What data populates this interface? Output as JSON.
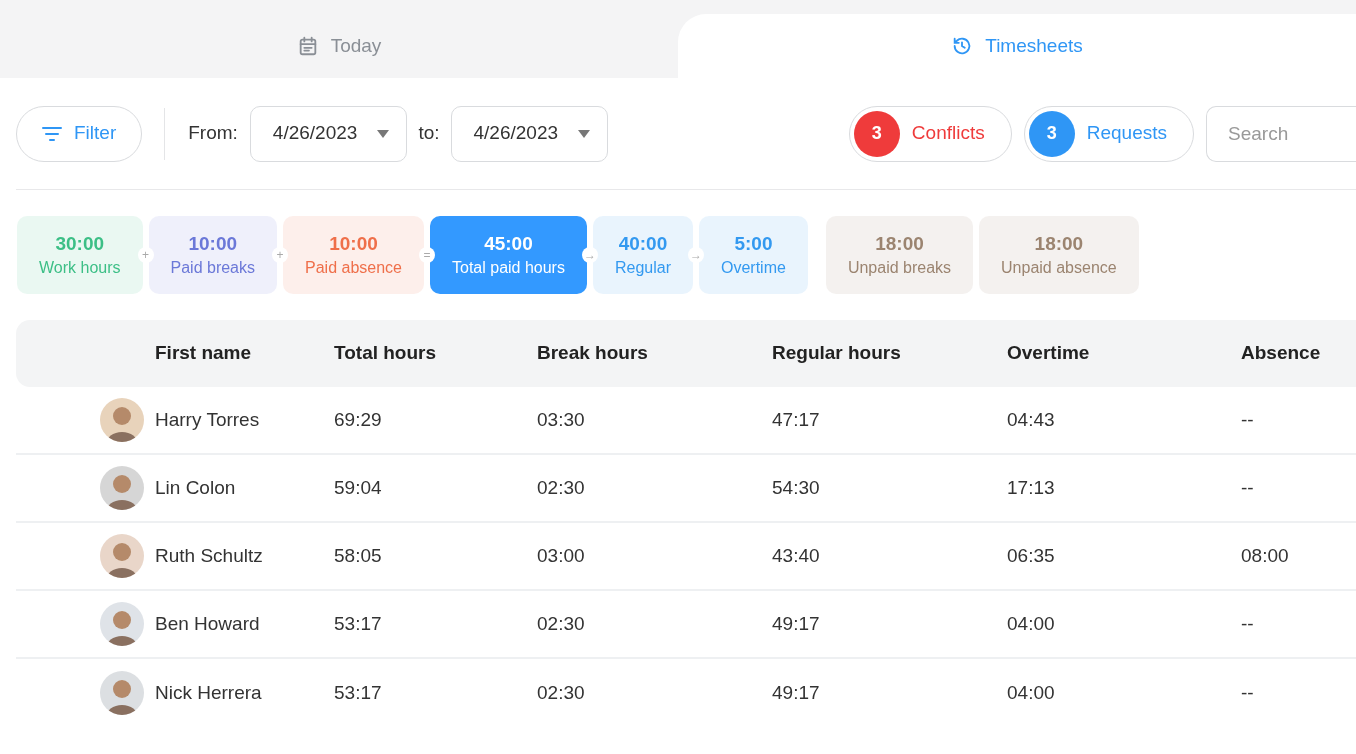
{
  "tabs": [
    {
      "label": "Today",
      "selected": false
    },
    {
      "label": "Timesheets",
      "selected": true
    }
  ],
  "toolbar": {
    "filter": "Filter",
    "from_label": "From:",
    "from_date": "4/26/2023",
    "to_label": "to:",
    "to_date": "4/26/2023",
    "badges": [
      {
        "count": "3",
        "label": "Conflicts",
        "color": "#ef3b3b"
      },
      {
        "count": "3",
        "label": "Requests",
        "color": "#2f96f5"
      }
    ],
    "search": {
      "placeholder": "Search"
    }
  },
  "summary": [
    {
      "value": "30:00",
      "label": "Work hours",
      "color": "#3cbf86",
      "selected": false,
      "operator": "+"
    },
    {
      "value": "10:00",
      "label": "Paid breaks",
      "color": "#6b78d8",
      "selected": false,
      "operator": "+"
    },
    {
      "value": "10:00",
      "label": "Paid absence",
      "color": "#ef6f4a",
      "selected": false,
      "operator": "="
    },
    {
      "value": "45:00",
      "label": "Total paid hours",
      "color": "#3399ff",
      "selected": true,
      "operator": "→"
    },
    {
      "value": "40:00",
      "label": "Regular",
      "color": "#3399f0",
      "selected": false,
      "operator": "→"
    },
    {
      "value": "5:00",
      "label": "Overtime",
      "color": "#3399f0",
      "selected": false
    },
    {
      "value": "18:00",
      "label": "Unpaid breaks",
      "color": "#9b8470",
      "selected": false,
      "group_start": true
    },
    {
      "value": "18:00",
      "label": "Unpaid absence",
      "color": "#9b8470",
      "selected": false
    }
  ],
  "table": {
    "columns": [
      "First name",
      "Total hours",
      "Break hours",
      "Regular hours",
      "Overtime",
      "Absence"
    ],
    "rows": [
      {
        "cells": [
          "Harry Torres",
          "69:29",
          "03:30",
          "47:17",
          "04:43",
          "--"
        ]
      },
      {
        "cells": [
          "Lin Colon",
          "59:04",
          "02:30",
          "54:30",
          "17:13",
          "--"
        ]
      },
      {
        "cells": [
          "Ruth Schultz",
          "58:05",
          "03:00",
          "43:40",
          "06:35",
          "08:00"
        ]
      },
      {
        "cells": [
          "Ben Howard",
          "53:17",
          "02:30",
          "49:17",
          "04:00",
          "--"
        ]
      },
      {
        "cells": [
          "Nick Herrera",
          "53:17",
          "02:30",
          "49:17",
          "04:00",
          "--"
        ]
      }
    ]
  }
}
